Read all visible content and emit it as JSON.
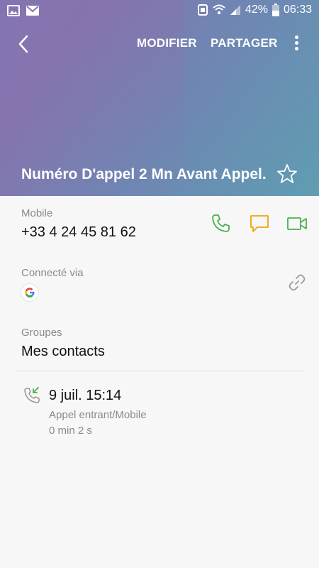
{
  "status_bar": {
    "battery_percent": "42%",
    "time": "06:33"
  },
  "toolbar": {
    "edit_label": "MODIFIER",
    "share_label": "PARTAGER"
  },
  "contact": {
    "name": "Numéro D'appel 2 Mn Avant Appel..."
  },
  "phone": {
    "label": "Mobile",
    "number": "+33 4 24 45 81 62"
  },
  "connected": {
    "label": "Connecté via",
    "service_icon": "google-icon"
  },
  "groups": {
    "label": "Groupes",
    "value": "Mes contacts"
  },
  "call_log": {
    "date": "9 juil. 15:14",
    "type": "Appel entrant/Mobile",
    "duration": "0 min 2 s"
  },
  "colors": {
    "call_green": "#4caf50",
    "message_orange": "#f0a30a",
    "video_green": "#4caf50",
    "header_start": "#7e7ab7",
    "header_end": "#5f9db2"
  }
}
